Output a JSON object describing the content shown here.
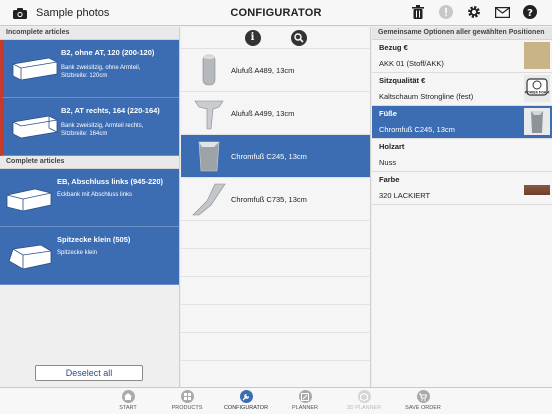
{
  "header": {
    "photos_label": "Sample photos",
    "title": "CONFIGURATOR"
  },
  "articles": {
    "incomplete_title": "Incomplete articles",
    "complete_title": "Complete articles",
    "incomplete": [
      {
        "name": "B2, ohne AT, 120 (200-120)",
        "desc1": "Bank zweisitzig, ohne Armteil,",
        "desc2": "Sitzbreite: 120cm"
      },
      {
        "name": "B2, AT rechts, 164 (220-164)",
        "desc1": "Bank zweisitzig, Armteil rechts,",
        "desc2": "Sitzbreite: 164cm"
      }
    ],
    "complete": [
      {
        "name": "EB, Abschluss links (945-220)",
        "desc1": "Eckbank mit Abschluss links"
      },
      {
        "name": "Spitzecke klein (505)",
        "desc1": "Spitzecke klein"
      }
    ],
    "deselect_label": "Deselect all"
  },
  "options": [
    {
      "label": "Alufuß A489, 13cm",
      "selected": false
    },
    {
      "label": "Alufuß A499, 13cm",
      "selected": false
    },
    {
      "label": "Chromfuß C245, 13cm",
      "selected": true
    },
    {
      "label": "Chromfuß C735, 13cm",
      "selected": false
    }
  ],
  "common": {
    "title": "Gemeinsame Optionen aller gewählten Positionen",
    "props": [
      {
        "key": "Bezug €",
        "value": "AKK 01 (Stoff/AKK)",
        "swatch": "#c8b487"
      },
      {
        "key": "Sitzqualität €",
        "value": "Kaltschaum Strongline (fest)",
        "badge": "POWER FOAM"
      },
      {
        "key": "Füße",
        "value": "Chromfuß C245, 13cm",
        "selected": true
      },
      {
        "key": "Holzart",
        "value": "Nuss"
      },
      {
        "key": "Farbe",
        "value": "320 LACKIERT",
        "swatch": "#7b4a34"
      }
    ]
  },
  "tabs": [
    {
      "label": "START",
      "icon": "home-icon"
    },
    {
      "label": "PRODUCTS",
      "icon": "grid-icon"
    },
    {
      "label": "CONFIGURATOR",
      "icon": "wrench-icon",
      "active": true
    },
    {
      "label": "PLANNER",
      "icon": "planner-icon"
    },
    {
      "label": "3D PLANNER",
      "icon": "cube-icon",
      "disabled": true
    },
    {
      "label": "SAVE ORDER",
      "icon": "cart-icon"
    }
  ]
}
